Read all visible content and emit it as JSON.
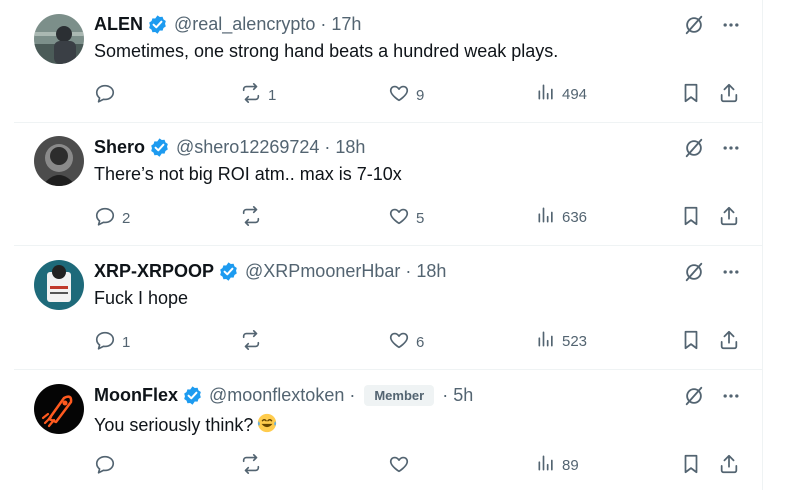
{
  "tweets": [
    {
      "name": "ALEN",
      "handle": "@real_alencrypto",
      "time": "17h",
      "text": "Sometimes, one strong hand beats a hundred weak plays.",
      "replies": "",
      "reposts": "1",
      "likes": "9",
      "views": "494"
    },
    {
      "name": "Shero",
      "handle": "@shero12269724",
      "time": "18h",
      "text": "There’s not big ROI atm.. max is 7-10x",
      "replies": "2",
      "reposts": "",
      "likes": "5",
      "views": "636"
    },
    {
      "name": "XRP-XRPOOP",
      "handle": "@XRPmoonerHbar",
      "time": "18h",
      "text": "Fuck I hope",
      "replies": "1",
      "reposts": "",
      "likes": "6",
      "views": "523"
    },
    {
      "name": "MoonFlex",
      "handle": "@moonflextoken",
      "badge": "Member",
      "time": "5h",
      "text": "You seriously think?",
      "emoji": "laughing-tears-emoji",
      "replies": "",
      "reposts": "",
      "likes": "",
      "views": "89"
    }
  ],
  "separator": "·",
  "colors": {
    "verified": "#1d9bf0",
    "text": "#0f1419",
    "muted": "#536471",
    "border": "#eff3f4"
  },
  "icons": [
    "verified-badge-icon",
    "grok-icon",
    "more-icon",
    "reply-icon",
    "repost-icon",
    "like-icon",
    "views-icon",
    "bookmark-icon",
    "share-icon"
  ]
}
